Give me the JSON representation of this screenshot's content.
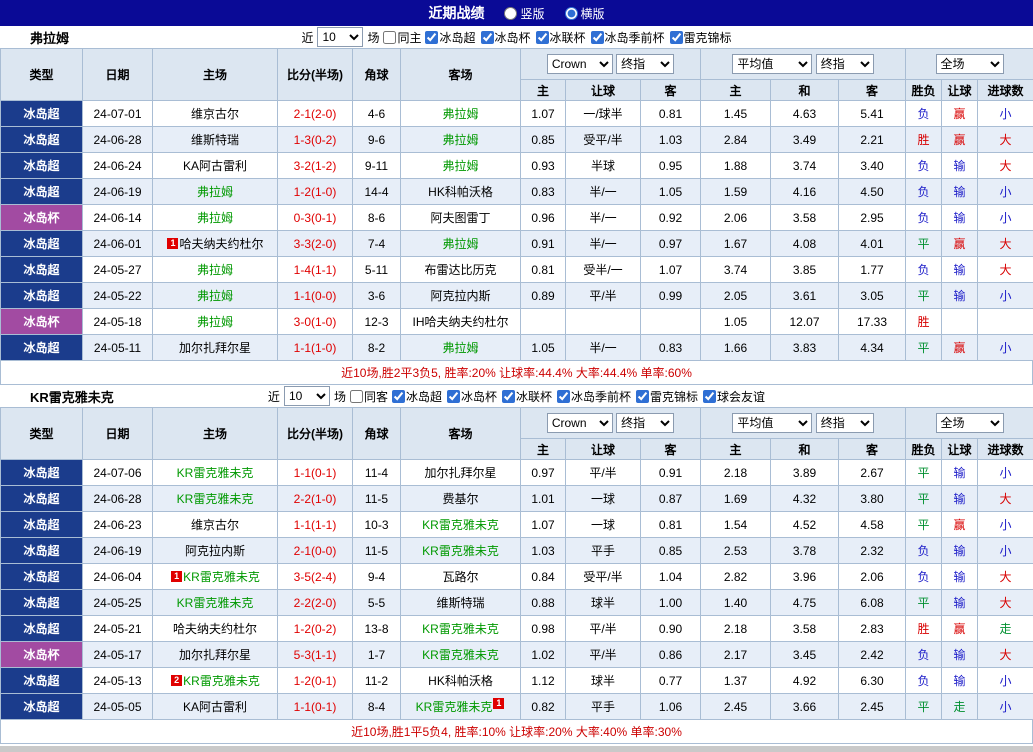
{
  "palette": {
    "red": "#d80000",
    "blue": "#1a1ac8",
    "green": "#009030",
    "focus_green": "#009900",
    "score_red": "#e00000",
    "league_super_bg": "#1b3c8c",
    "league_cup_bg": "#a24ba2",
    "topbar_bg": "#0a0a96",
    "header_bg": "#dce6f1",
    "stripe_bg": "#e7eef8",
    "footer_red": "#cc0000"
  },
  "topbar": {
    "title": "近期战绩",
    "radios": [
      {
        "label": "竖版",
        "selected": false
      },
      {
        "label": "横版",
        "selected": true
      }
    ]
  },
  "table_headers": {
    "left": [
      "类型",
      "日期",
      "主场",
      "比分(半场)",
      "角球",
      "客场"
    ],
    "sub": [
      "主",
      "让球",
      "客",
      "主",
      "和",
      "客",
      "胜负",
      "让球",
      "进球数"
    ],
    "selects": {
      "book": "Crown",
      "book_final": "终指",
      "avg": "平均值",
      "avg_final": "终指",
      "scope": "全场"
    }
  },
  "sections": [
    {
      "team": "弗拉姆",
      "filters": {
        "prefix": "近",
        "count": "10",
        "suffix": "场",
        "same": {
          "label": "同主",
          "checked": false
        },
        "leagues": [
          {
            "label": "冰岛超",
            "checked": true
          },
          {
            "label": "冰岛杯",
            "checked": true
          },
          {
            "label": "冰联杯",
            "checked": true
          },
          {
            "label": "冰岛季前杯",
            "checked": true
          },
          {
            "label": "雷克锦标",
            "checked": true
          }
        ]
      },
      "rows": [
        {
          "league": "冰岛超",
          "league_type": "super",
          "date": "24-07-01",
          "home": "维京古尔",
          "home_focus": false,
          "home_badge": null,
          "score": "2-1(2-0)",
          "corners": "4-6",
          "away": "弗拉姆",
          "away_focus": true,
          "away_badge": null,
          "ah": [
            "1.07",
            "一/球半",
            "0.81"
          ],
          "eu": [
            "1.45",
            "4.63",
            "5.41"
          ],
          "result": {
            "text": "负",
            "color": "blue"
          },
          "handicap": {
            "text": "赢",
            "color": "red"
          },
          "goals": {
            "text": "小",
            "color": "blue"
          }
        },
        {
          "league": "冰岛超",
          "league_type": "super",
          "date": "24-06-28",
          "home": "维斯特瑞",
          "home_focus": false,
          "home_badge": null,
          "score": "1-3(0-2)",
          "corners": "9-6",
          "away": "弗拉姆",
          "away_focus": true,
          "away_badge": null,
          "ah": [
            "0.85",
            "受平/半",
            "1.03"
          ],
          "eu": [
            "2.84",
            "3.49",
            "2.21"
          ],
          "result": {
            "text": "胜",
            "color": "red"
          },
          "handicap": {
            "text": "赢",
            "color": "red"
          },
          "goals": {
            "text": "大",
            "color": "red"
          }
        },
        {
          "league": "冰岛超",
          "league_type": "super",
          "date": "24-06-24",
          "home": "KA阿古雷利",
          "home_focus": false,
          "home_badge": null,
          "score": "3-2(1-2)",
          "corners": "9-11",
          "away": "弗拉姆",
          "away_focus": true,
          "away_badge": null,
          "ah": [
            "0.93",
            "半球",
            "0.95"
          ],
          "eu": [
            "1.88",
            "3.74",
            "3.40"
          ],
          "result": {
            "text": "负",
            "color": "blue"
          },
          "handicap": {
            "text": "输",
            "color": "blue"
          },
          "goals": {
            "text": "大",
            "color": "red"
          }
        },
        {
          "league": "冰岛超",
          "league_type": "super",
          "date": "24-06-19",
          "home": "弗拉姆",
          "home_focus": true,
          "home_badge": null,
          "score": "1-2(1-0)",
          "corners": "14-4",
          "away": "HK科帕沃格",
          "away_focus": false,
          "away_badge": null,
          "ah": [
            "0.83",
            "半/一",
            "1.05"
          ],
          "eu": [
            "1.59",
            "4.16",
            "4.50"
          ],
          "result": {
            "text": "负",
            "color": "blue"
          },
          "handicap": {
            "text": "输",
            "color": "blue"
          },
          "goals": {
            "text": "小",
            "color": "blue"
          }
        },
        {
          "league": "冰岛杯",
          "league_type": "cup",
          "date": "24-06-14",
          "home": "弗拉姆",
          "home_focus": true,
          "home_badge": null,
          "score": "0-3(0-1)",
          "corners": "8-6",
          "away": "阿夫图雷丁",
          "away_focus": false,
          "away_badge": null,
          "ah": [
            "0.96",
            "半/一",
            "0.92"
          ],
          "eu": [
            "2.06",
            "3.58",
            "2.95"
          ],
          "result": {
            "text": "负",
            "color": "blue"
          },
          "handicap": {
            "text": "输",
            "color": "blue"
          },
          "goals": {
            "text": "小",
            "color": "blue"
          }
        },
        {
          "league": "冰岛超",
          "league_type": "super",
          "date": "24-06-01",
          "home": "哈夫纳夫约杜尔",
          "home_focus": false,
          "home_badge": {
            "text": "1",
            "pos": "before"
          },
          "score": "3-3(2-0)",
          "corners": "7-4",
          "away": "弗拉姆",
          "away_focus": true,
          "away_badge": null,
          "ah": [
            "0.91",
            "半/一",
            "0.97"
          ],
          "eu": [
            "1.67",
            "4.08",
            "4.01"
          ],
          "result": {
            "text": "平",
            "color": "green"
          },
          "handicap": {
            "text": "赢",
            "color": "red"
          },
          "goals": {
            "text": "大",
            "color": "red"
          }
        },
        {
          "league": "冰岛超",
          "league_type": "super",
          "date": "24-05-27",
          "home": "弗拉姆",
          "home_focus": true,
          "home_badge": null,
          "score": "1-4(1-1)",
          "corners": "5-11",
          "away": "布雷达比历克",
          "away_focus": false,
          "away_badge": null,
          "ah": [
            "0.81",
            "受半/一",
            "1.07"
          ],
          "eu": [
            "3.74",
            "3.85",
            "1.77"
          ],
          "result": {
            "text": "负",
            "color": "blue"
          },
          "handicap": {
            "text": "输",
            "color": "blue"
          },
          "goals": {
            "text": "大",
            "color": "red"
          }
        },
        {
          "league": "冰岛超",
          "league_type": "super",
          "date": "24-05-22",
          "home": "弗拉姆",
          "home_focus": true,
          "home_badge": null,
          "score": "1-1(0-0)",
          "corners": "3-6",
          "away": "阿克拉内斯",
          "away_focus": false,
          "away_badge": null,
          "ah": [
            "0.89",
            "平/半",
            "0.99"
          ],
          "eu": [
            "2.05",
            "3.61",
            "3.05"
          ],
          "result": {
            "text": "平",
            "color": "green"
          },
          "handicap": {
            "text": "输",
            "color": "blue"
          },
          "goals": {
            "text": "小",
            "color": "blue"
          }
        },
        {
          "league": "冰岛杯",
          "league_type": "cup",
          "date": "24-05-18",
          "home": "弗拉姆",
          "home_focus": true,
          "home_badge": null,
          "score": "3-0(1-0)",
          "corners": "12-3",
          "away": "IH哈夫纳夫约杜尔",
          "away_focus": false,
          "away_badge": null,
          "ah": [
            "",
            "",
            ""
          ],
          "eu": [
            "1.05",
            "12.07",
            "17.33"
          ],
          "result": {
            "text": "胜",
            "color": "red"
          },
          "handicap": {
            "text": "",
            "color": "none"
          },
          "goals": {
            "text": "",
            "color": "none"
          }
        },
        {
          "league": "冰岛超",
          "league_type": "super",
          "date": "24-05-11",
          "home": "加尔扎拜尔星",
          "home_focus": false,
          "home_badge": null,
          "score": "1-1(1-0)",
          "corners": "8-2",
          "away": "弗拉姆",
          "away_focus": true,
          "away_badge": null,
          "ah": [
            "1.05",
            "半/一",
            "0.83"
          ],
          "eu": [
            "1.66",
            "3.83",
            "4.34"
          ],
          "result": {
            "text": "平",
            "color": "green"
          },
          "handicap": {
            "text": "赢",
            "color": "red"
          },
          "goals": {
            "text": "小",
            "color": "blue"
          }
        }
      ],
      "summary": "近10场,胜2平3负5, 胜率:20% 让球率:44.4% 大率:44.4% 单率:60%"
    },
    {
      "team": "KR雷克雅未克",
      "filters": {
        "prefix": "近",
        "count": "10",
        "suffix": "场",
        "same": {
          "label": "同客",
          "checked": false
        },
        "leagues": [
          {
            "label": "冰岛超",
            "checked": true
          },
          {
            "label": "冰岛杯",
            "checked": true
          },
          {
            "label": "冰联杯",
            "checked": true
          },
          {
            "label": "冰岛季前杯",
            "checked": true
          },
          {
            "label": "雷克锦标",
            "checked": true
          },
          {
            "label": "球会友谊",
            "checked": true
          }
        ]
      },
      "rows": [
        {
          "league": "冰岛超",
          "league_type": "super",
          "date": "24-07-06",
          "home": "KR雷克雅未克",
          "home_focus": true,
          "home_badge": null,
          "score": "1-1(0-1)",
          "corners": "11-4",
          "away": "加尔扎拜尔星",
          "away_focus": false,
          "away_badge": null,
          "ah": [
            "0.97",
            "平/半",
            "0.91"
          ],
          "eu": [
            "2.18",
            "3.89",
            "2.67"
          ],
          "result": {
            "text": "平",
            "color": "green"
          },
          "handicap": {
            "text": "输",
            "color": "blue"
          },
          "goals": {
            "text": "小",
            "color": "blue"
          }
        },
        {
          "league": "冰岛超",
          "league_type": "super",
          "date": "24-06-28",
          "home": "KR雷克雅未克",
          "home_focus": true,
          "home_badge": null,
          "score": "2-2(1-0)",
          "corners": "11-5",
          "away": "费基尔",
          "away_focus": false,
          "away_badge": null,
          "ah": [
            "1.01",
            "一球",
            "0.87"
          ],
          "eu": [
            "1.69",
            "4.32",
            "3.80"
          ],
          "result": {
            "text": "平",
            "color": "green"
          },
          "handicap": {
            "text": "输",
            "color": "blue"
          },
          "goals": {
            "text": "大",
            "color": "red"
          }
        },
        {
          "league": "冰岛超",
          "league_type": "super",
          "date": "24-06-23",
          "home": "维京古尔",
          "home_focus": false,
          "home_badge": null,
          "score": "1-1(1-1)",
          "corners": "10-3",
          "away": "KR雷克雅未克",
          "away_focus": true,
          "away_badge": null,
          "ah": [
            "1.07",
            "一球",
            "0.81"
          ],
          "eu": [
            "1.54",
            "4.52",
            "4.58"
          ],
          "result": {
            "text": "平",
            "color": "green"
          },
          "handicap": {
            "text": "赢",
            "color": "red"
          },
          "goals": {
            "text": "小",
            "color": "blue"
          }
        },
        {
          "league": "冰岛超",
          "league_type": "super",
          "date": "24-06-19",
          "home": "阿克拉内斯",
          "home_focus": false,
          "home_badge": null,
          "score": "2-1(0-0)",
          "corners": "11-5",
          "away": "KR雷克雅未克",
          "away_focus": true,
          "away_badge": null,
          "ah": [
            "1.03",
            "平手",
            "0.85"
          ],
          "eu": [
            "2.53",
            "3.78",
            "2.32"
          ],
          "result": {
            "text": "负",
            "color": "blue"
          },
          "handicap": {
            "text": "输",
            "color": "blue"
          },
          "goals": {
            "text": "小",
            "color": "blue"
          }
        },
        {
          "league": "冰岛超",
          "league_type": "super",
          "date": "24-06-04",
          "home": "KR雷克雅未克",
          "home_focus": true,
          "home_badge": {
            "text": "1",
            "pos": "before"
          },
          "score": "3-5(2-4)",
          "corners": "9-4",
          "away": "瓦路尔",
          "away_focus": false,
          "away_badge": null,
          "ah": [
            "0.84",
            "受平/半",
            "1.04"
          ],
          "eu": [
            "2.82",
            "3.96",
            "2.06"
          ],
          "result": {
            "text": "负",
            "color": "blue"
          },
          "handicap": {
            "text": "输",
            "color": "blue"
          },
          "goals": {
            "text": "大",
            "color": "red"
          }
        },
        {
          "league": "冰岛超",
          "league_type": "super",
          "date": "24-05-25",
          "home": "KR雷克雅未克",
          "home_focus": true,
          "home_badge": null,
          "score": "2-2(2-0)",
          "corners": "5-5",
          "away": "维斯特瑞",
          "away_focus": false,
          "away_badge": null,
          "ah": [
            "0.88",
            "球半",
            "1.00"
          ],
          "eu": [
            "1.40",
            "4.75",
            "6.08"
          ],
          "result": {
            "text": "平",
            "color": "green"
          },
          "handicap": {
            "text": "输",
            "color": "blue"
          },
          "goals": {
            "text": "大",
            "color": "red"
          }
        },
        {
          "league": "冰岛超",
          "league_type": "super",
          "date": "24-05-21",
          "home": "哈夫纳夫约杜尔",
          "home_focus": false,
          "home_badge": null,
          "score": "1-2(0-2)",
          "corners": "13-8",
          "away": "KR雷克雅未克",
          "away_focus": true,
          "away_badge": null,
          "ah": [
            "0.98",
            "平/半",
            "0.90"
          ],
          "eu": [
            "2.18",
            "3.58",
            "2.83"
          ],
          "result": {
            "text": "胜",
            "color": "red"
          },
          "handicap": {
            "text": "赢",
            "color": "red"
          },
          "goals": {
            "text": "走",
            "color": "green"
          }
        },
        {
          "league": "冰岛杯",
          "league_type": "cup",
          "date": "24-05-17",
          "home": "加尔扎拜尔星",
          "home_focus": false,
          "home_badge": null,
          "score": "5-3(1-1)",
          "corners": "1-7",
          "away": "KR雷克雅未克",
          "away_focus": true,
          "away_badge": null,
          "ah": [
            "1.02",
            "平/半",
            "0.86"
          ],
          "eu": [
            "2.17",
            "3.45",
            "2.42"
          ],
          "result": {
            "text": "负",
            "color": "blue"
          },
          "handicap": {
            "text": "输",
            "color": "blue"
          },
          "goals": {
            "text": "大",
            "color": "red"
          }
        },
        {
          "league": "冰岛超",
          "league_type": "super",
          "date": "24-05-13",
          "home": "KR雷克雅未克",
          "home_focus": true,
          "home_badge": {
            "text": "2",
            "pos": "before"
          },
          "score": "1-2(0-1)",
          "corners": "11-2",
          "away": "HK科帕沃格",
          "away_focus": false,
          "away_badge": null,
          "ah": [
            "1.12",
            "球半",
            "0.77"
          ],
          "eu": [
            "1.37",
            "4.92",
            "6.30"
          ],
          "result": {
            "text": "负",
            "color": "blue"
          },
          "handicap": {
            "text": "输",
            "color": "blue"
          },
          "goals": {
            "text": "小",
            "color": "blue"
          }
        },
        {
          "league": "冰岛超",
          "league_type": "super",
          "date": "24-05-05",
          "home": "KA阿古雷利",
          "home_focus": false,
          "home_badge": null,
          "score": "1-1(0-1)",
          "corners": "8-4",
          "away": "KR雷克雅未克",
          "away_focus": true,
          "away_badge": {
            "text": "1",
            "pos": "after"
          },
          "ah": [
            "0.82",
            "平手",
            "1.06"
          ],
          "eu": [
            "2.45",
            "3.66",
            "2.45"
          ],
          "result": {
            "text": "平",
            "color": "green"
          },
          "handicap": {
            "text": "走",
            "color": "green"
          },
          "goals": {
            "text": "小",
            "color": "blue"
          }
        }
      ],
      "summary": "近10场,胜1平5负4, 胜率:10% 让球率:20% 大率:40% 单率:30%"
    }
  ]
}
